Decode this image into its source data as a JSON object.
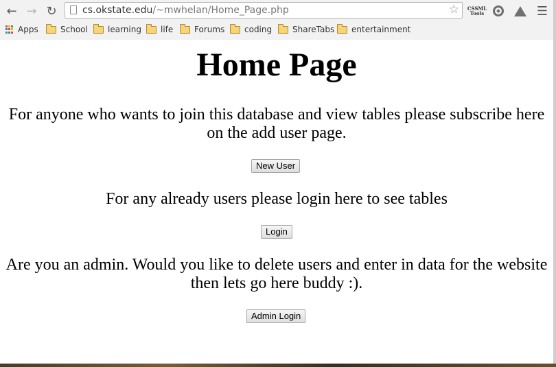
{
  "browser": {
    "url_host": "cs.okstate.edu",
    "url_path": "/~mwhelan/Home_Page.php",
    "back_icon": "back-arrow-icon",
    "forward_icon": "forward-arrow-icon",
    "reload_icon": "reload-icon",
    "extension_cssml_label": "CSSML Tools",
    "bookmarks": [
      {
        "label": "Apps",
        "icon": "apps-grid-icon"
      },
      {
        "label": "School",
        "icon": "folder-icon"
      },
      {
        "label": "learning",
        "icon": "folder-icon"
      },
      {
        "label": "life",
        "icon": "folder-icon"
      },
      {
        "label": "Forums",
        "icon": "folder-icon"
      },
      {
        "label": "coding",
        "icon": "folder-icon"
      },
      {
        "label": "ShareTabs",
        "icon": "folder-icon"
      },
      {
        "label": "entertainment",
        "icon": "folder-icon"
      }
    ]
  },
  "page": {
    "title": "Home Page",
    "subscribe_text": "For anyone who wants to join this database and view tables please subscribe here on the add user page.",
    "new_user_button": "New User",
    "login_text": "For any already users please login here to see tables",
    "login_button": "Login",
    "admin_text": "Are you an admin. Would you like to delete users and enter in data for the website then lets go here buddy :).",
    "admin_login_button": "Admin Login"
  }
}
